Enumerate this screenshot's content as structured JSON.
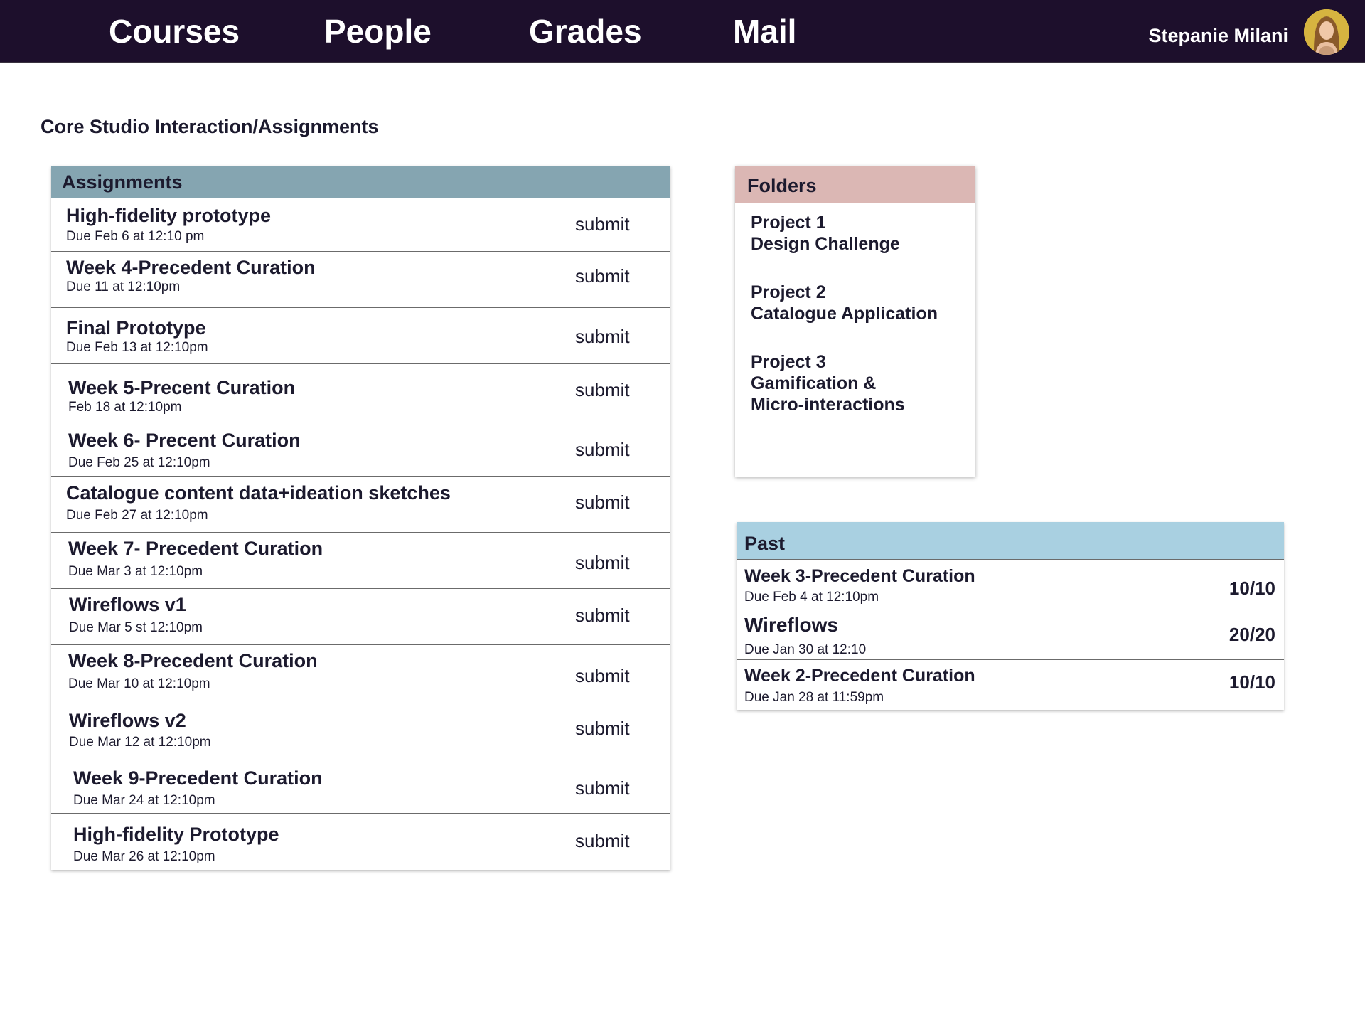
{
  "nav": {
    "items": [
      "Courses",
      "People",
      "Grades",
      "Mail"
    ],
    "user_name": "Stepanie Milani"
  },
  "page": {
    "title": "Core Studio Interaction/Assignments"
  },
  "assignments": {
    "header": "Assignments",
    "rows": [
      {
        "title": "High-fidelity prototype",
        "due": "Due Feb 6 at 12:10 pm",
        "action": "submit"
      },
      {
        "title": "Week 4-Precedent Curation",
        "due": "Due 11 at 12:10pm",
        "action": "submit"
      },
      {
        "title": "Final Prototype",
        "due": "Due Feb 13 at 12:10pm",
        "action": "submit"
      },
      {
        "title": "Week 5-Precent Curation",
        "due": "Feb 18 at 12:10pm",
        "action": "submit"
      },
      {
        "title": "Week 6- Precent Curation",
        "due": "Due Feb 25 at 12:10pm",
        "action": "submit"
      },
      {
        "title": "Catalogue content data+ideation sketches",
        "due": "Due Feb 27 at 12:10pm",
        "action": "submit"
      },
      {
        "title": "Week 7- Precedent Curation",
        "due": "Due Mar 3 at 12:10pm",
        "action": "submit"
      },
      {
        "title": "Wireflows v1",
        "due": "Due Mar 5 st 12:10pm",
        "action": "submit"
      },
      {
        "title": "Week 8-Precedent Curation",
        "due": "Due Mar 10 at 12:10pm",
        "action": "submit"
      },
      {
        "title": "Wireflows v2",
        "due": "Due Mar 12 at 12:10pm",
        "action": "submit"
      },
      {
        "title": "Week 9-Precedent Curation",
        "due": "Due Mar 24 at 12:10pm",
        "action": "submit"
      },
      {
        "title": "High-fidelity Prototype",
        "due": "Due Mar 26 at 12:10pm",
        "action": "submit"
      }
    ]
  },
  "folders": {
    "header": "Folders",
    "items": [
      {
        "lines": [
          "Project 1",
          "Design Challenge"
        ]
      },
      {
        "lines": [
          "Project 2",
          "Catalogue Application"
        ]
      },
      {
        "lines": [
          "Project 3",
          "Gamification &",
          "Micro-interactions"
        ]
      }
    ]
  },
  "past": {
    "header": "Past",
    "rows": [
      {
        "title": "Week 3-Precedent Curation",
        "due": "Due Feb 4 at 12:10pm",
        "score": "10/10"
      },
      {
        "title": "Wireflows",
        "due": "Due Jan 30 at 12:10",
        "score": "20/20"
      },
      {
        "title": "Week 2-Precedent Curation",
        "due": "Due Jan 28 at 11:59pm",
        "score": "10/10"
      }
    ]
  },
  "colors": {
    "nav_bg": "#1d0f2c",
    "assignments_header": "#85a5b1",
    "folders_header": "#dbb7b4",
    "past_header": "#a9d0e1"
  }
}
